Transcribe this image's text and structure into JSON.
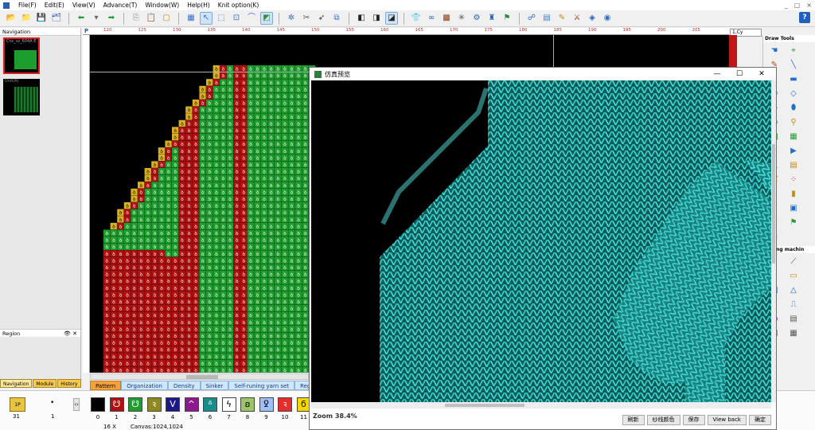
{
  "menu": {
    "items": [
      "File(F)",
      "Edit(E)",
      "View(V)",
      "Advance(T)",
      "Window(W)",
      "Help(H)",
      "Knit option(K)"
    ],
    "window_controls": [
      "_",
      "▢",
      "×"
    ]
  },
  "toolbar": {
    "icons": [
      "open-folder-icon",
      "folder-icon",
      "save-icon",
      "save-as-icon",
      "undo-icon",
      "dropdown-icon",
      "redo-icon",
      "copy-icon",
      "paste-icon",
      "page-icon",
      "grid-icon",
      "cursor-icon",
      "select-icon",
      "rect-select-icon",
      "magic-icon",
      "preview-icon",
      "settings-icon",
      "scissors-icon",
      "yarn-icon",
      "transfer-icon",
      "color-a-icon",
      "color-b-icon",
      "color-c-icon",
      "sweater-icon",
      "link-icon",
      "pattern-icon",
      "brightness-icon",
      "factory-icon",
      "tuning-icon",
      "puzzle-icon",
      "web-icon",
      "note-icon",
      "pencil-icon",
      "tie-icon",
      "tag-icon",
      "globe-icon"
    ],
    "help": "?"
  },
  "nav_panel": {
    "title": "Navigation",
    "thumb1_label": "Cnc_sz_604A E",
    "thumb2_label": "Unit(A)",
    "region_label": "Region",
    "tabs": [
      "Navigation",
      "Module",
      "History"
    ]
  },
  "ruler": {
    "corner": "P",
    "marks": [
      "120",
      "125",
      "130",
      "135",
      "140",
      "145",
      "150",
      "155",
      "160",
      "165",
      "170",
      "175",
      "180",
      "185",
      "190",
      "195",
      "200",
      "205"
    ]
  },
  "zoom_select": "1,Cy",
  "tools_panel": {
    "draw_title": "Draw Tools",
    "knit_title": "nitting machin",
    "draw_tools": [
      "hand-icon",
      "pick-icon",
      "pen-icon",
      "line-icon",
      "curve-icon",
      "rect-icon",
      "ellipse-icon",
      "diamond-icon",
      "diamond-fill-icon",
      "capsule-icon",
      "circle-icon",
      "eyedropper-icon",
      "green-square-icon",
      "grid-tool-icon",
      "wave-icon",
      "arrow-tool-icon",
      "mirror-icon",
      "pattern-tool-icon",
      "bucket-icon",
      "dots-icon",
      "align-icon",
      "bar-icon",
      "columns-icon",
      "window-icon",
      "stack-icon",
      "flag-icon",
      "layers-icon"
    ],
    "knit_tools": [
      "machine-icon",
      "needle-icon",
      "sweater-tool-icon",
      "plate-icon",
      "book-icon",
      "triangle-icon",
      "ruler-icon",
      "hook-icon",
      "purple-circle-icon",
      "sheet-icon",
      "lock-icon",
      "calendar-icon"
    ]
  },
  "bottom_tabs": [
    "Pattern",
    "Organization",
    "Density",
    "Sinker",
    "Self-runing yarn set",
    "Region"
  ],
  "palette": {
    "current_label": "1P",
    "current_count": "31",
    "dot_count": "1",
    "swatches": [
      {
        "num": "0",
        "bg": "#000000",
        "sym": ""
      },
      {
        "num": "1",
        "bg": "#b01010",
        "sym": "☋"
      },
      {
        "num": "2",
        "bg": "#1e9e2e",
        "sym": "☋"
      },
      {
        "num": "3",
        "bg": "#8f8a20",
        "sym": "ꝛ"
      },
      {
        "num": "4",
        "bg": "#1a1a8c",
        "sym": "V"
      },
      {
        "num": "5",
        "bg": "#8c1a8c",
        "sym": "^"
      },
      {
        "num": "6",
        "bg": "#1a8c8c",
        "sym": "ᐞ"
      },
      {
        "num": "7",
        "bg": "#ffffff",
        "sym": "ϟ"
      },
      {
        "num": "8",
        "bg": "#9ec46a",
        "sym": "ꞛ"
      },
      {
        "num": "9",
        "bg": "#9ec0ff",
        "sym": "ꝿ"
      },
      {
        "num": "10",
        "bg": "#e82c2c",
        "sym": "ꝛ"
      },
      {
        "num": "11",
        "bg": "#f6d800",
        "sym": "ϭ"
      }
    ],
    "status_zoom": "16 X",
    "status_canvas": "Canvas:1024,1024"
  },
  "preview": {
    "title": "仿真预览",
    "zoom_label": "Zoom 38.4%",
    "buttons": [
      "刷新",
      "纱线颜色",
      "保存",
      "View back",
      "确定"
    ]
  },
  "colors": {
    "red": "#b01010",
    "green": "#1e9e2e",
    "gold": "#d8b020",
    "knit": "#27c4c0"
  }
}
